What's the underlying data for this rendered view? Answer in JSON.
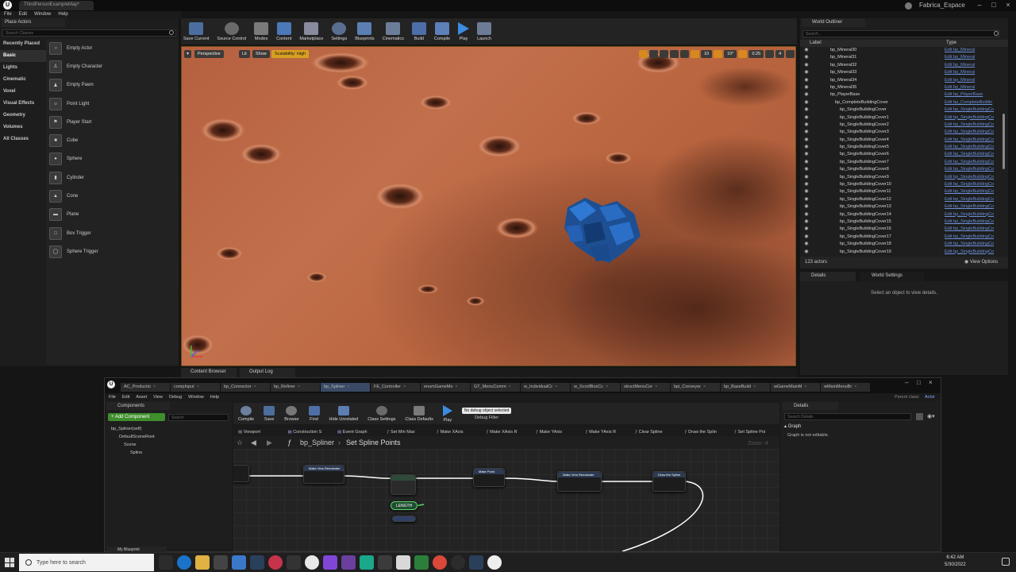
{
  "window": {
    "doc_tab": "ThirdPersonExampleMap*",
    "project_name": "Fabrica_Espace",
    "menu": [
      "File",
      "Edit",
      "Window",
      "Help"
    ]
  },
  "place_actors": {
    "tab_title": "Place Actors",
    "search_placeholder": "Search Classes",
    "categories": [
      "Recently Placed",
      "Basic",
      "Lights",
      "Cinematic",
      "Voxel",
      "Visual Effects",
      "Geometry",
      "Volumes",
      "All Classes"
    ],
    "selected_category": "Basic",
    "actors": [
      "Empty Actor",
      "Empty Character",
      "Empty Pawn",
      "Point Light",
      "Player Start",
      "Cube",
      "Sphere",
      "Cylinder",
      "Cone",
      "Plane",
      "Box Trigger",
      "Sphere Trigger"
    ]
  },
  "toolbar": {
    "buttons": [
      "Save Current",
      "Source Control",
      "Modes",
      "Content",
      "Marketplace",
      "Settings",
      "Blueprints",
      "Cinematics",
      "Build",
      "Compile",
      "Play",
      "Launch"
    ]
  },
  "viewport": {
    "perspective": "Perspective",
    "lit": "Lit",
    "show": "Show",
    "scalability": "Scalability: High",
    "grid_snap": "10",
    "rot_snap": "10°",
    "scale_snap": "0.25",
    "cam_speed": "4"
  },
  "bottom_tabs": [
    "Content Browser",
    "Output Log"
  ],
  "outliner": {
    "tab_title": "World Outliner",
    "search_placeholder": "Search...",
    "col_label": "Label",
    "col_type": "Type",
    "rows": [
      {
        "label": "bp_Mineral30",
        "type": "Edit bp_Mineral"
      },
      {
        "label": "bp_Mineral31",
        "type": "Edit bp_Mineral"
      },
      {
        "label": "bp_Mineral32",
        "type": "Edit bp_Mineral"
      },
      {
        "label": "bp_Mineral33",
        "type": "Edit bp_Mineral"
      },
      {
        "label": "bp_Mineral34",
        "type": "Edit bp_Mineral"
      },
      {
        "label": "bp_Mineral35",
        "type": "Edit bp_Mineral"
      },
      {
        "label": "bp_PlayerBase",
        "type": "Edit bp_PlayerBase"
      },
      {
        "label": "bp_CompleteBuildingCover",
        "type": "Edit bp_CompleteBuildin"
      },
      {
        "label": "bp_SingleBuildingCover",
        "type": "Edit bp_SingleBuildingCo"
      },
      {
        "label": "bp_SingleBuildingCover1",
        "type": "Edit bp_SingleBuildingCo"
      },
      {
        "label": "bp_SingleBuildingCover2",
        "type": "Edit bp_SingleBuildingCo"
      },
      {
        "label": "bp_SingleBuildingCover3",
        "type": "Edit bp_SingleBuildingCo"
      },
      {
        "label": "bp_SingleBuildingCover4",
        "type": "Edit bp_SingleBuildingCo"
      },
      {
        "label": "bp_SingleBuildingCover5",
        "type": "Edit bp_SingleBuildingCo"
      },
      {
        "label": "bp_SingleBuildingCover6",
        "type": "Edit bp_SingleBuildingCo"
      },
      {
        "label": "bp_SingleBuildingCover7",
        "type": "Edit bp_SingleBuildingCo"
      },
      {
        "label": "bp_SingleBuildingCover8",
        "type": "Edit bp_SingleBuildingCo"
      },
      {
        "label": "bp_SingleBuildingCover9",
        "type": "Edit bp_SingleBuildingCo"
      },
      {
        "label": "bp_SingleBuildingCover10",
        "type": "Edit bp_SingleBuildingCo"
      },
      {
        "label": "bp_SingleBuildingCover11",
        "type": "Edit bp_SingleBuildingCo"
      },
      {
        "label": "bp_SingleBuildingCover12",
        "type": "Edit bp_SingleBuildingCo"
      },
      {
        "label": "bp_SingleBuildingCover13",
        "type": "Edit bp_SingleBuildingCo"
      },
      {
        "label": "bp_SingleBuildingCover14",
        "type": "Edit bp_SingleBuildingCo"
      },
      {
        "label": "bp_SingleBuildingCover15",
        "type": "Edit bp_SingleBuildingCo"
      },
      {
        "label": "bp_SingleBuildingCover16",
        "type": "Edit bp_SingleBuildingCo"
      },
      {
        "label": "bp_SingleBuildingCover17",
        "type": "Edit bp_SingleBuildingCo"
      },
      {
        "label": "bp_SingleBuildingCover18",
        "type": "Edit bp_SingleBuildingCo"
      },
      {
        "label": "bp_SingleBuildingCover19",
        "type": "Edit bp_SingleBuildingCo"
      }
    ],
    "actor_count": "123 actors",
    "view_options": "View Options"
  },
  "details": {
    "tab_details": "Details",
    "tab_world_settings": "World Settings",
    "empty_text": "Select an object to view details."
  },
  "bp_editor": {
    "tabs": [
      "AC_Productio",
      "compInput",
      "bp_Connector",
      "bp_Refiner",
      "bp_Spliner",
      "FE_Controller",
      "enumGameMo",
      "GT_MenuComm",
      "w_IndividualCr",
      "w_ScrollBoxCc",
      "structMenuCor",
      "bpi_Conveyor",
      "bp_BaseBuild",
      "wGameMainM",
      "wMainMenuBr"
    ],
    "active_tab": "bp_Spliner",
    "parent_class_label": "Parent class:",
    "parent_class_value": "Actor",
    "menu": [
      "File",
      "Edit",
      "Asset",
      "View",
      "Debug",
      "Window",
      "Help"
    ],
    "components_title": "Components",
    "add_component": "+ Add Component",
    "search_placeholder": "Search",
    "tree": [
      "bp_Spliner(self)",
      "DefaultSceneRoot",
      "Scene",
      "Spline"
    ],
    "my_blueprint_tab": "My Blueprint",
    "toolbar": [
      "Compile",
      "Save",
      "Browse",
      "Find",
      "Hide Unrelated",
      "Class Settings",
      "Class Defaults",
      "Play"
    ],
    "debug_filter_value": "No debug object selected",
    "debug_filter_label": "Debug Filter",
    "function_tabs": [
      "Viewport",
      "Construction S",
      "Event Graph",
      "Set Min Max",
      "Make XAxis",
      "Make XAxis R",
      "Make YAxis",
      "Make YAxis R",
      "Clear Spline",
      "Draw the Splin",
      "Set Spline Poi"
    ],
    "breadcrumb_root": "bp_Spliner",
    "breadcrumb_fn": "Set Spline Points",
    "zoom": "Zoom -4",
    "details_title": "Details",
    "details_search": "Search Details",
    "graph_section": "Graph",
    "graph_note": "Graph is not editable.",
    "nodes": [
      "Make Vers Remainder",
      "Make Point",
      "Make Vers Remainder",
      "Draw the Spline"
    ],
    "length_node": "LENGTH"
  },
  "taskbar": {
    "search_placeholder": "Type here to search",
    "time": "6:42 AM",
    "date": "5/30/2022"
  }
}
